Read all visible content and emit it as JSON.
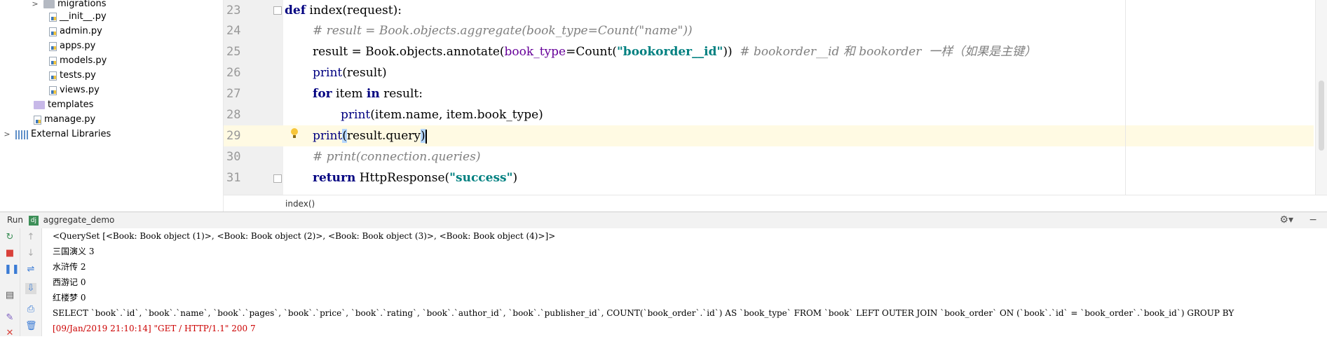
{
  "project_tree": {
    "items": [
      {
        "label": "migrations",
        "type": "folder-grey",
        "arrow": ">"
      },
      {
        "label": "__init__.py",
        "type": "py"
      },
      {
        "label": "admin.py",
        "type": "py"
      },
      {
        "label": "apps.py",
        "type": "py"
      },
      {
        "label": "models.py",
        "type": "py"
      },
      {
        "label": "tests.py",
        "type": "py"
      },
      {
        "label": "views.py",
        "type": "py"
      },
      {
        "label": "templates",
        "type": "folder"
      },
      {
        "label": "manage.py",
        "type": "py"
      },
      {
        "label": "External Libraries",
        "type": "libs",
        "arrow": ">"
      }
    ]
  },
  "editor": {
    "line_numbers": [
      "23",
      "24",
      "25",
      "26",
      "27",
      "28",
      "29",
      "30",
      "31"
    ],
    "lines": {
      "l23_def": "def",
      "l23_rest": " index(request):",
      "l24_comment": "# result = Book.objects.aggregate(book_type=Count(\"name\"))",
      "l25_a": "result = Book.objects.annotate(",
      "l25_kwarg": "book_type",
      "l25_b": "=Count(",
      "l25_str": "\"bookorder__id\"",
      "l25_c": "))  ",
      "l25_comment": "# bookorder__id 和 bookorder  一样（如果是主键）",
      "l26_print": "print",
      "l26_rest": "(result)",
      "l27_for": "for",
      "l27_mid": " item ",
      "l27_in": "in",
      "l27_rest": " result:",
      "l28_print": "print",
      "l28_rest": "(item.name, item.book_type)",
      "l29_print": "print",
      "l29_paren": "(",
      "l29_mid": "result.query",
      "l29_close": ")",
      "l30_comment": "# print(connection.queries)",
      "l31_return": "return",
      "l31_a": " HttpResponse(",
      "l31_str": "\"success\"",
      "l31_b": ")"
    },
    "breadcrumb": "index()"
  },
  "run_panel": {
    "title_prefix": "Run",
    "config_name": "aggregate_demo",
    "output": [
      "<QuerySet [<Book: Book object (1)>, <Book: Book object (2)>, <Book: Book object (3)>, <Book: Book object (4)>]>",
      "三国演义 3",
      "水浒传 2",
      "西游记 0",
      "红楼梦 0",
      "SELECT `book`.`id`, `book`.`name`, `book`.`pages`, `book`.`price`, `book`.`rating`, `book`.`author_id`, `book`.`publisher_id`, COUNT(`book_order`.`id`) AS `book_type` FROM `book` LEFT OUTER JOIN `book_order` ON (`book`.`id` = `book_order`.`book_id`) GROUP BY",
      "[09/Jan/2019 21:10:14] \"GET / HTTP/1.1\" 200 7"
    ]
  },
  "colors": {
    "keyword": "#000080",
    "string": "#008080",
    "comment": "#808080",
    "kwarg": "#660099",
    "current_line": "#fffae3",
    "error_output": "#cc0000"
  }
}
